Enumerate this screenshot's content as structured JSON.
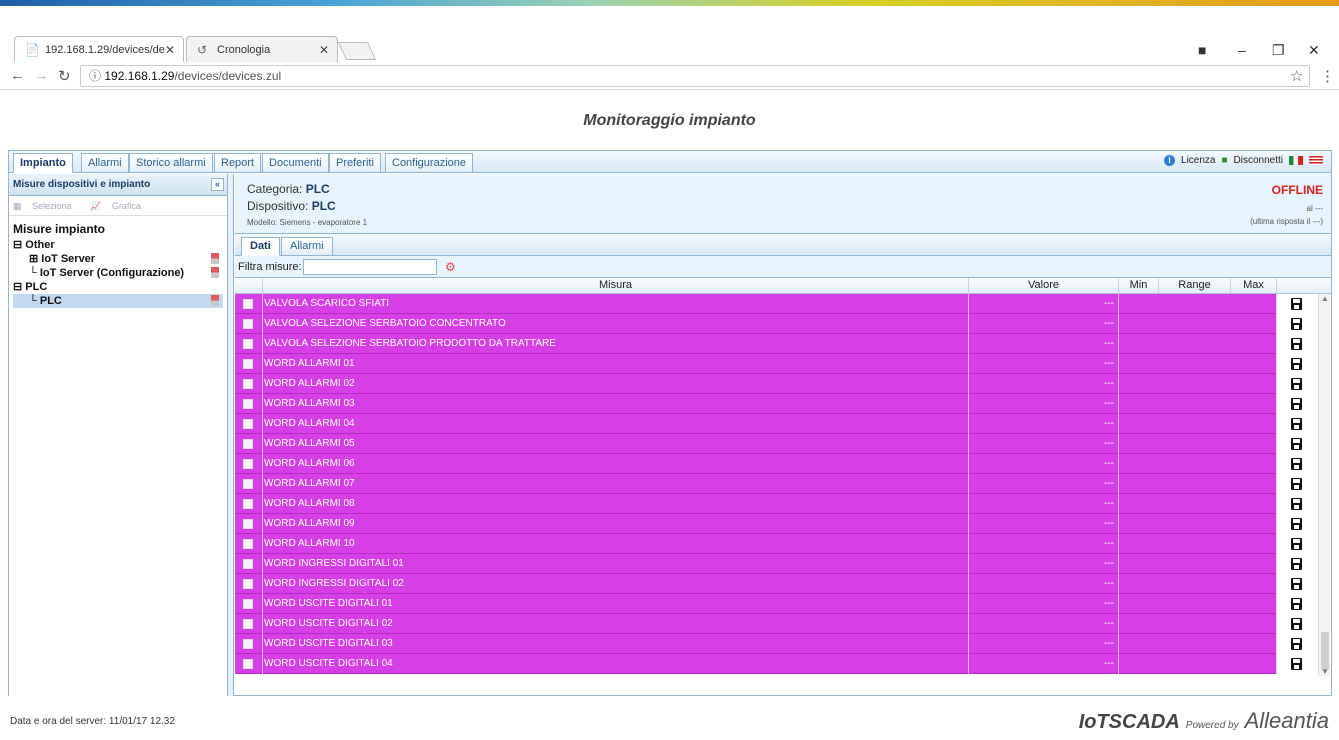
{
  "browser": {
    "tabs": [
      {
        "label": "192.168.1.29/devices/de"
      },
      {
        "label": "Cronologia"
      }
    ],
    "url_host": "192.168.1.29",
    "url_path": "/devices/devices.zul"
  },
  "page": {
    "title": "Monitoraggio impianto"
  },
  "app_tabs": [
    "Impianto",
    "Allarmi",
    "Storico allarmi",
    "Report",
    "Documenti",
    "Preferiti",
    "Configurazione"
  ],
  "topright": {
    "license": "Licenza",
    "disconnect": "Disconnetti"
  },
  "left": {
    "header": "Misure dispositivi e impianto",
    "tools": {
      "select": "Seleziona",
      "chart": "Grafica"
    },
    "tree_root": "Misure impianto",
    "groups": [
      {
        "label": "Other",
        "items": [
          "IoT Server",
          "IoT Server (Configurazione)"
        ]
      },
      {
        "label": "PLC",
        "items": [
          "PLC"
        ]
      }
    ]
  },
  "device": {
    "category_label": "Categoria:",
    "category_value": "PLC",
    "device_label": "Dispositivo:",
    "device_value": "PLC",
    "model": "Modello: Siemens - evaporatore 1",
    "status": "OFFLINE",
    "status_line1": "al ---",
    "status_line2": "(ultima risposta il ---)"
  },
  "subtabs": [
    "Dati",
    "Allarmi"
  ],
  "filter": {
    "label": "Filtra misure:",
    "value": ""
  },
  "grid": {
    "columns": {
      "misura": "Misura",
      "valore": "Valore",
      "min": "Min",
      "range": "Range",
      "max": "Max"
    },
    "rows": [
      {
        "name": "VALVOLA SCARICO SFIATI",
        "value": "---"
      },
      {
        "name": "VALVOLA SELEZIONE SERBATOIO CONCENTRATO",
        "value": "---"
      },
      {
        "name": "VALVOLA SELEZIONE SERBATOIO PRODOTTO DA TRATTARE",
        "value": "---"
      },
      {
        "name": "WORD ALLARMI 01",
        "value": "---"
      },
      {
        "name": "WORD ALLARMI 02",
        "value": "---"
      },
      {
        "name": "WORD ALLARMI 03",
        "value": "---"
      },
      {
        "name": "WORD ALLARMI 04",
        "value": "---"
      },
      {
        "name": "WORD ALLARMI 05",
        "value": "---"
      },
      {
        "name": "WORD ALLARMI 06",
        "value": "---"
      },
      {
        "name": "WORD ALLARMI 07",
        "value": "---"
      },
      {
        "name": "WORD ALLARMI 08",
        "value": "---"
      },
      {
        "name": "WORD ALLARMI 09",
        "value": "---"
      },
      {
        "name": "WORD ALLARMI 10",
        "value": "---"
      },
      {
        "name": "WORD INGRESSI DIGITALI 01",
        "value": "---"
      },
      {
        "name": "WORD INGRESSI DIGITALI 02",
        "value": "---"
      },
      {
        "name": "WORD USCITE DIGITALI 01",
        "value": "---"
      },
      {
        "name": "WORD USCITE DIGITALI 02",
        "value": "---"
      },
      {
        "name": "WORD USCITE DIGITALI 03",
        "value": "---"
      },
      {
        "name": "WORD USCITE DIGITALI 04",
        "value": "---"
      }
    ]
  },
  "footer": {
    "server_time": "Data e ora del server: 11/01/17 12.32",
    "logo_main": "IoTSCADA",
    "logo_powered": "Powered by",
    "logo_company": "Alleantia"
  },
  "colors": {
    "row_bg": "#d63ee6",
    "status": "#d21f1f",
    "accent": "#1a3c66"
  }
}
